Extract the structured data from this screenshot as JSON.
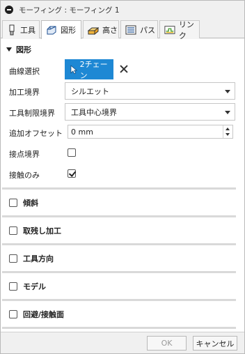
{
  "window": {
    "title": "モーフィング : モーフィング 1"
  },
  "tabs": [
    {
      "label": "工具",
      "icon": "tool-icon"
    },
    {
      "label": "図形",
      "icon": "shape-icon"
    },
    {
      "label": "高さ",
      "icon": "heights-icon"
    },
    {
      "label": "パス",
      "icon": "passes-icon"
    },
    {
      "label": "リンク",
      "icon": "linking-icon"
    }
  ],
  "active_tab": "図形",
  "geometry": {
    "title": "図形",
    "curve_select": {
      "label": "曲線選択",
      "button": "2チェーン"
    },
    "machining_boundary": {
      "label": "加工境界",
      "value": "シルエット"
    },
    "tool_containment": {
      "label": "工具制限境界",
      "value": "工具中心境界"
    },
    "additional_offset": {
      "label": "追加オフセット",
      "value": "0 mm"
    },
    "touch_boundary": {
      "label": "接点境界",
      "checked": false
    },
    "contact_only": {
      "label": "接触のみ",
      "checked": true
    }
  },
  "groups": [
    {
      "label": "傾斜",
      "checked": false
    },
    {
      "label": "取残し加工",
      "checked": false
    },
    {
      "label": "工具方向",
      "checked": false
    },
    {
      "label": "モデル",
      "checked": false
    },
    {
      "label": "回避/接触面",
      "checked": false
    }
  ],
  "footer": {
    "ok": "OK",
    "cancel": "キャンセル"
  },
  "colors": {
    "accent": "#1e88d4"
  }
}
